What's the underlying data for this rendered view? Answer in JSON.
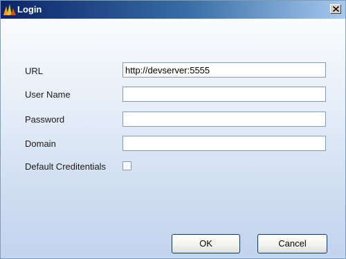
{
  "window": {
    "title": "Login"
  },
  "form": {
    "url_label": "URL",
    "url_value": "http://devserver:5555",
    "username_label": "User Name",
    "username_value": "",
    "password_label": "Password",
    "password_value": "",
    "domain_label": "Domain",
    "domain_value": "",
    "default_credentials_label": "Default Creditentials",
    "default_credentials_checked": false
  },
  "buttons": {
    "ok_label": "OK",
    "cancel_label": "Cancel"
  },
  "icons": {
    "app": "app-logo-icon",
    "close": "close-icon"
  }
}
